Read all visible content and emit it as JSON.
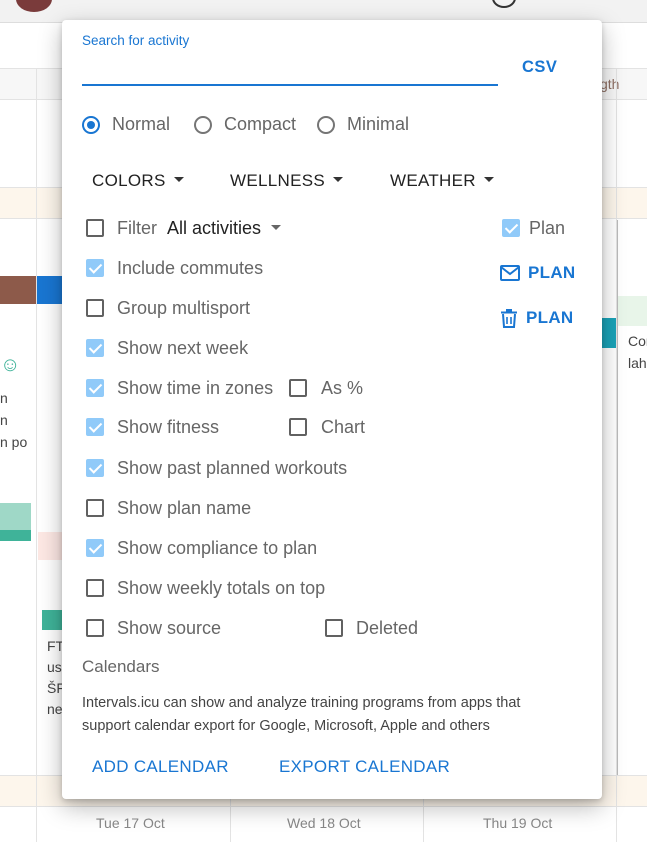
{
  "background": {
    "day_labels": [
      "Tue 17 Oct",
      "Wed 18 Oct",
      "Thu 19 Oct"
    ],
    "fragments": {
      "right_header": "gth",
      "left_lines": [
        "n",
        "n",
        "n po"
      ],
      "right_lines": [
        "Cor",
        "lah"
      ],
      "bottom_lines": [
        "FT",
        "us",
        "ŠF",
        "ne"
      ]
    }
  },
  "dialog": {
    "search": {
      "label": "Search for activity",
      "value": ""
    },
    "csv_label": "CSV",
    "view_modes": [
      {
        "label": "Normal",
        "selected": true
      },
      {
        "label": "Compact",
        "selected": false
      },
      {
        "label": "Minimal",
        "selected": false
      }
    ],
    "dropdowns": {
      "colors": "COLORS",
      "wellness": "WELLNESS",
      "weather": "WEATHER"
    },
    "filter": {
      "label": "Filter",
      "value": "All activities",
      "checked": false
    },
    "plan_checkbox": {
      "label": "Plan",
      "checked": true
    },
    "plan_email_label": "PLAN",
    "plan_delete_label": "PLAN",
    "options": {
      "include_commutes": {
        "label": "Include commutes",
        "checked": true
      },
      "group_multisport": {
        "label": "Group multisport",
        "checked": false
      },
      "show_next_week": {
        "label": "Show next week",
        "checked": true
      },
      "show_time_in_zones": {
        "label": "Show time in zones",
        "checked": true
      },
      "as_percent": {
        "label": "As %",
        "checked": false
      },
      "show_fitness": {
        "label": "Show fitness",
        "checked": true
      },
      "chart": {
        "label": "Chart",
        "checked": false
      },
      "show_past_planned": {
        "label": "Show past planned workouts",
        "checked": true
      },
      "show_plan_name": {
        "label": "Show plan name",
        "checked": false
      },
      "show_compliance": {
        "label": "Show compliance to plan",
        "checked": true
      },
      "show_weekly_totals": {
        "label": "Show weekly totals on top",
        "checked": false
      },
      "show_source": {
        "label": "Show source",
        "checked": false
      },
      "deleted": {
        "label": "Deleted",
        "checked": false
      }
    },
    "calendars": {
      "heading": "Calendars",
      "description": "Intervals.icu can show and analyze training programs from apps that support calendar export for Google, Microsoft, Apple and others",
      "add_label": "ADD CALENDAR",
      "export_label": "EXPORT CALENDAR"
    }
  },
  "colors": {
    "accent": "#1976d2",
    "checkbox_checked": "#90caf9"
  }
}
